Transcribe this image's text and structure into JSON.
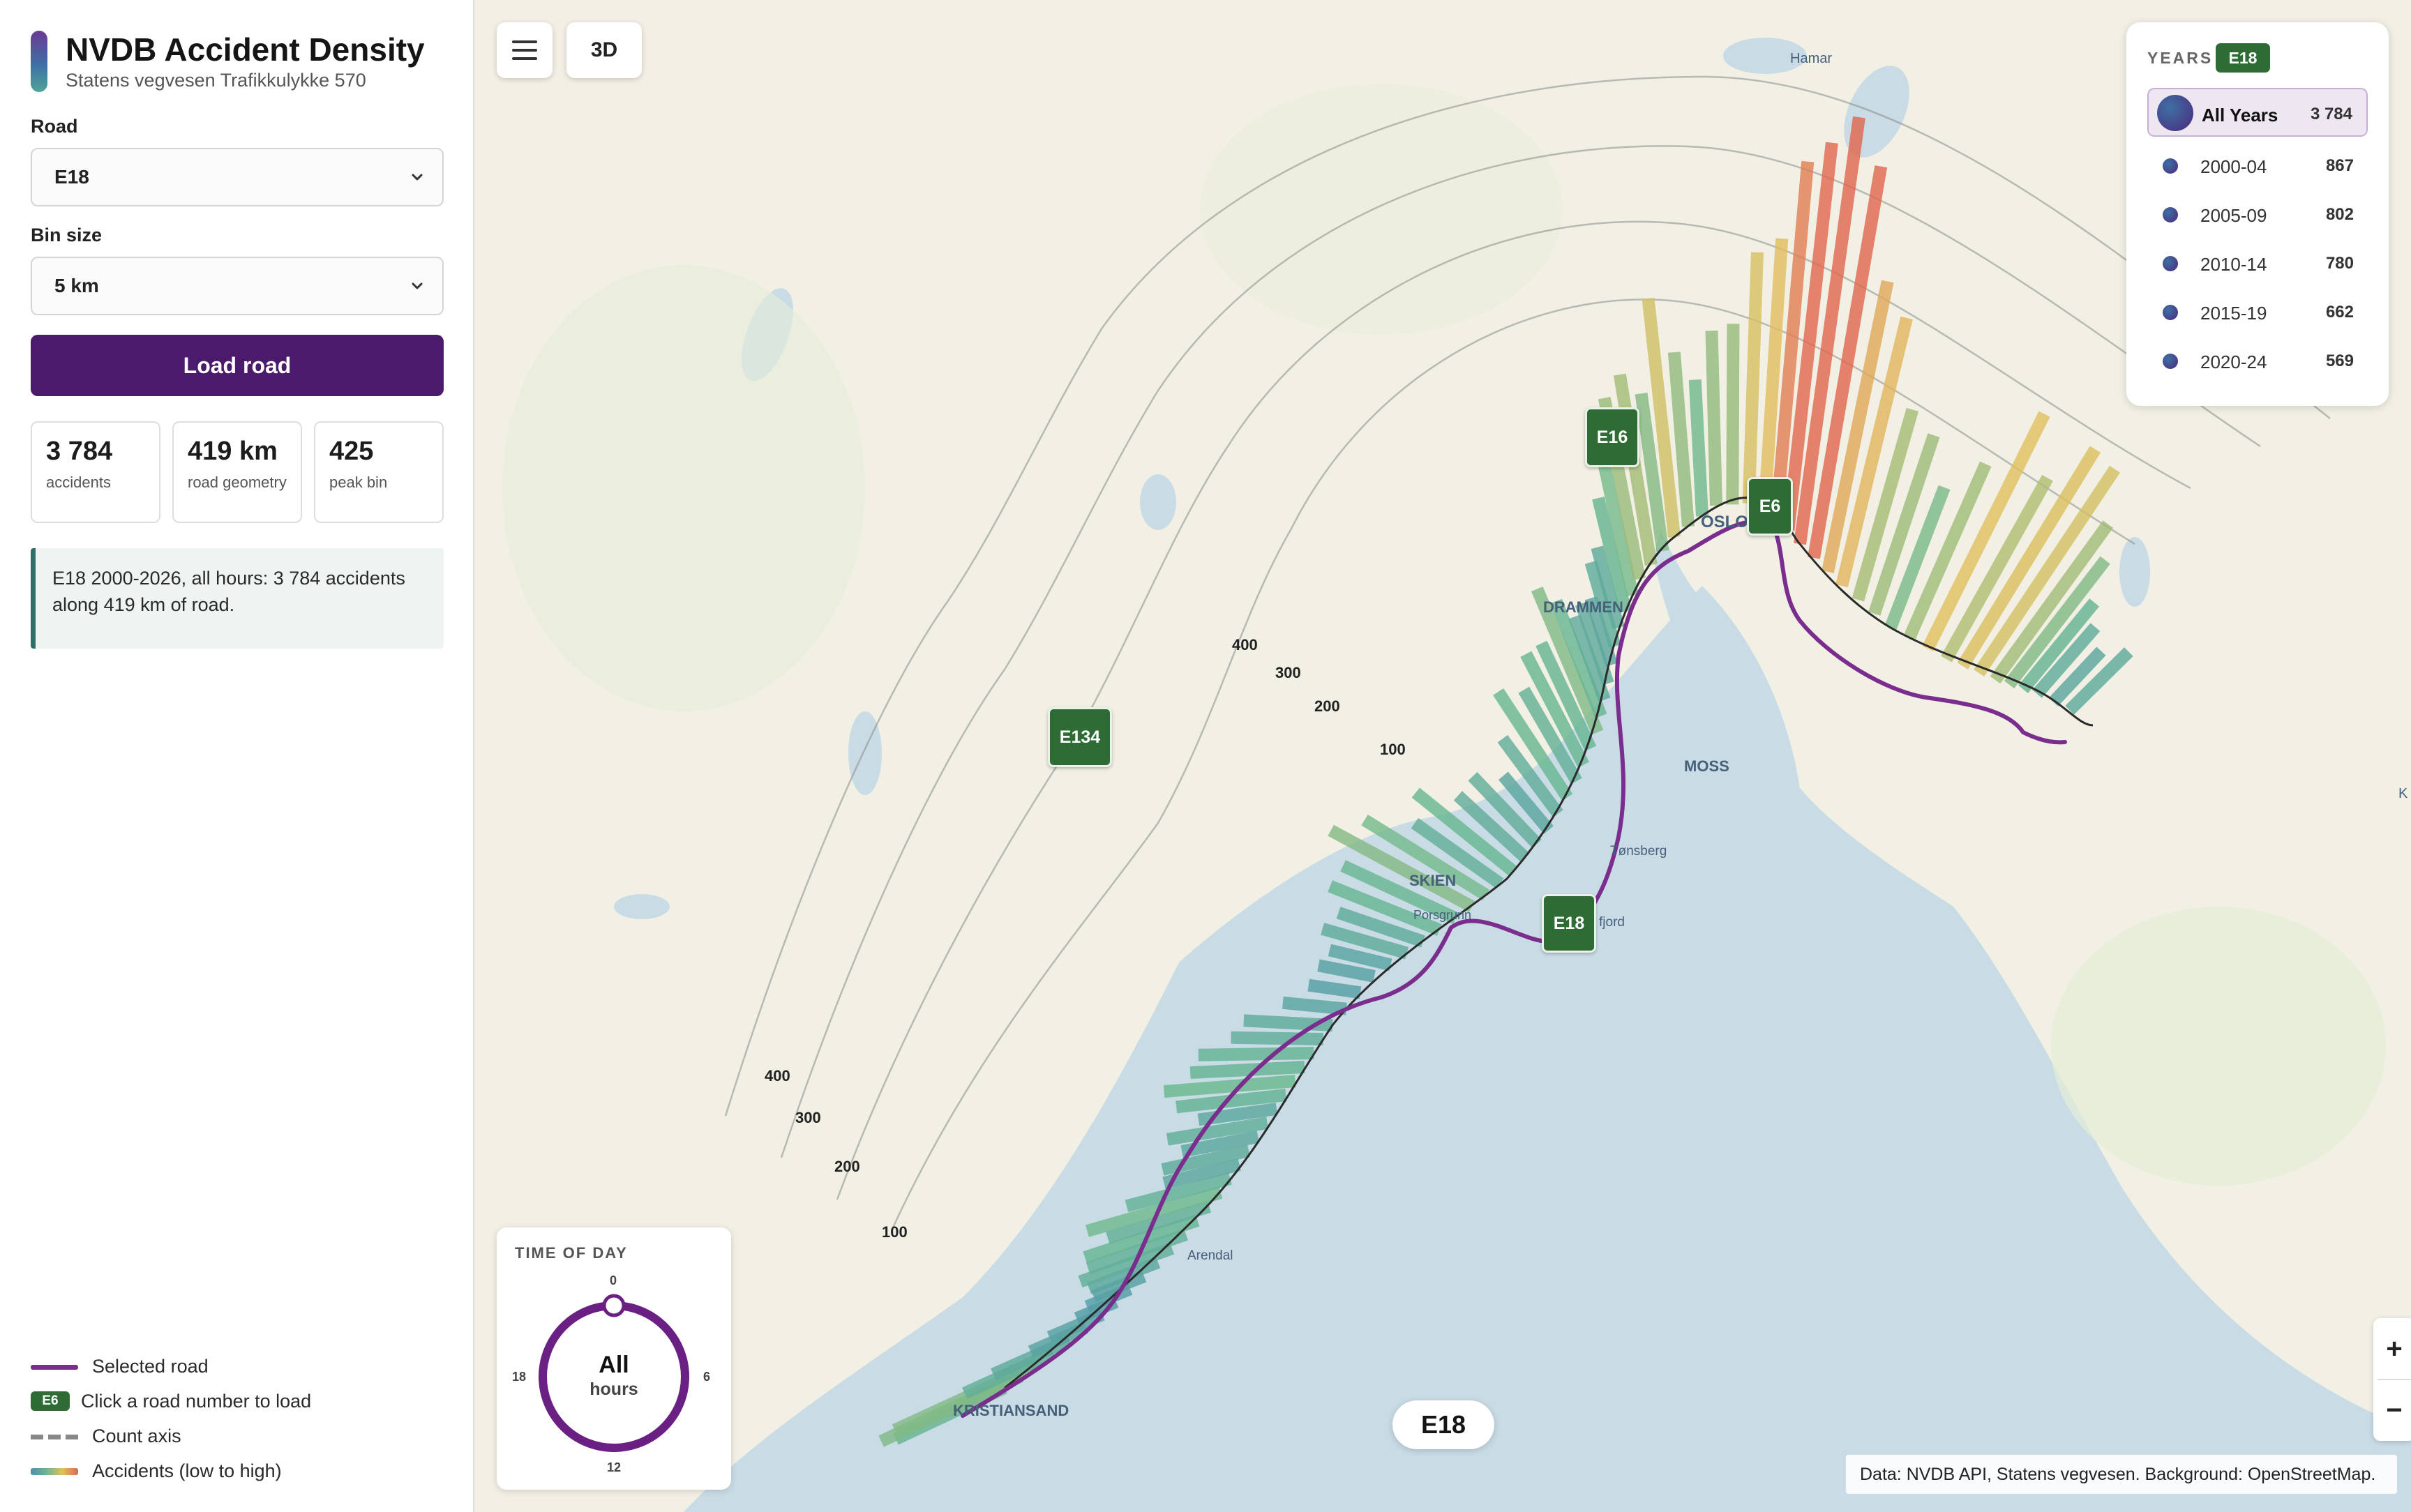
{
  "app": {
    "title": "NVDB Accident Density",
    "subtitle": "Statens vegvesen Trafikkulykke 570"
  },
  "controls": {
    "road_label": "Road",
    "road_value": "E18",
    "bin_label": "Bin size",
    "bin_value": "5 km",
    "load_button": "Load road"
  },
  "stats": [
    {
      "value": "3 784",
      "label": "accidents"
    },
    {
      "value": "419 km",
      "label": "road geometry"
    },
    {
      "value": "425",
      "label": "peak bin"
    }
  ],
  "summary": "E18 2000-2026, all hours: 3 784 accidents along 419 km of road.",
  "legend": {
    "selected_road": "Selected road",
    "road_badge": "E6",
    "road_hint": "Click a road number to load",
    "count_axis": "Count axis",
    "accidents": "Accidents (low to high)"
  },
  "map_toolbar": {
    "view_3d": "3D"
  },
  "years": {
    "title": "YEARS",
    "road_badge": "E18",
    "rows": [
      {
        "label": "All Years",
        "count": "3 784"
      },
      {
        "label": "2000-04",
        "count": "867"
      },
      {
        "label": "2005-09",
        "count": "802"
      },
      {
        "label": "2010-14",
        "count": "780"
      },
      {
        "label": "2015-19",
        "count": "662"
      },
      {
        "label": "2020-24",
        "count": "569"
      }
    ]
  },
  "time_of_day": {
    "title": "TIME OF DAY",
    "labels": {
      "top": "0",
      "right": "6",
      "bottom": "12",
      "left": "18"
    },
    "center_main": "All",
    "center_sub": "hours"
  },
  "map": {
    "current_road": "E18",
    "attribution": "Data: NVDB API, Statens vegvesen. Background: OpenStreetMap.",
    "zoom_in": "+",
    "zoom_out": "−",
    "road_badges": {
      "e16": "E16",
      "e6": "E6",
      "e134": "E134",
      "e18": "E18"
    },
    "places": {
      "hamar": "Hamar",
      "oslo": "OSLO",
      "drammen": "DRAMMEN",
      "moss": "MOSS",
      "tonsberg": "Tønsberg",
      "skien": "SKIEN",
      "porsgrunn": "Porsgrunn",
      "sandefjord": "fjord",
      "arendal": "Arendal",
      "kristiansand": "KRISTIANSAND",
      "edge_k": "K"
    },
    "count_axis_labels": {
      "a100": "100",
      "a200": "200",
      "a300": "300",
      "a400": "400",
      "b100": "100",
      "b200": "200",
      "b300": "300",
      "b400": "400"
    }
  }
}
